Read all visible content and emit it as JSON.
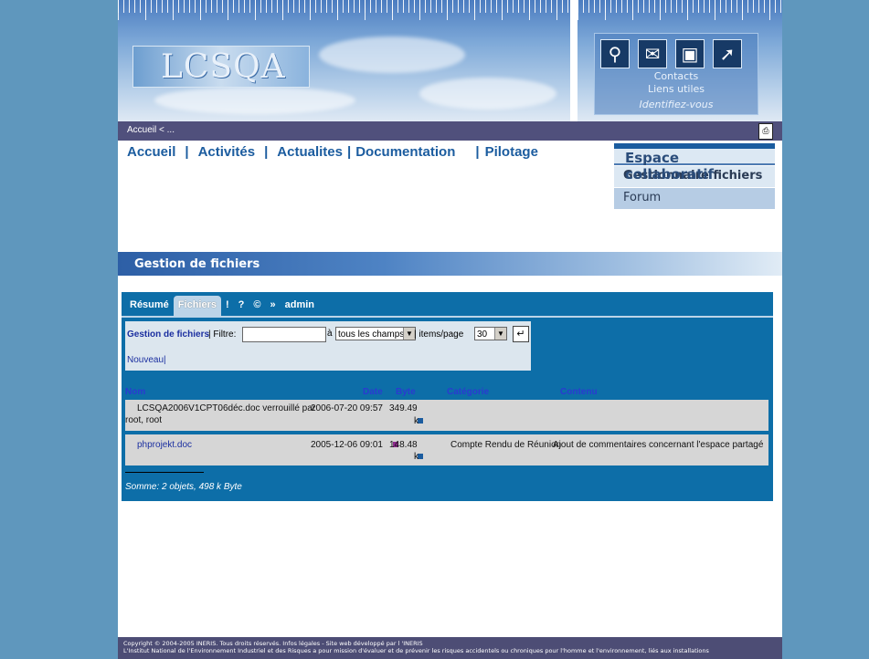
{
  "header": {
    "logo_text": "LCSQA",
    "toolbox": {
      "icons": [
        "search-icon",
        "mail-icon",
        "fullscreen-icon",
        "compass-icon"
      ],
      "contacts": "Contacts",
      "liens": "Liens utiles",
      "identify": "Identifiez-vous"
    }
  },
  "breadcrumb": {
    "text": "Accueil  < ..."
  },
  "nav": {
    "items": [
      "Accueil",
      "Activités",
      "Actualites",
      "Documentation",
      "Pilotage"
    ],
    "separator": "|"
  },
  "side_menu": {
    "title": "Espace collaboratif",
    "items": [
      "Gestionnaire fichiers",
      "Forum"
    ]
  },
  "section": {
    "title": "Gestion de fichiers"
  },
  "app": {
    "tabs": [
      "Résumé",
      "Fichiers",
      "!",
      "?",
      "©",
      "»",
      "admin"
    ],
    "filter": {
      "title": "Gestion de fichiers",
      "filter_label": "| Filtre:",
      "a_label": "à",
      "field_select": "tous les champs",
      "items_label": "|  items/page",
      "items_select": "30",
      "new_link": "Nouveau",
      "new_sep": "|"
    },
    "table": {
      "headers": [
        "Nom",
        "Date",
        "Byte",
        "Catégorie",
        "Contenu"
      ],
      "rows": [
        {
          "name_line1": "LCSQA2006V1CPT06déc.doc verrouillé par",
          "name_line2": "root, root",
          "date": "2006-07-20 09:57",
          "byte": "349.49",
          "unit": "k",
          "category": "",
          "content": ""
        },
        {
          "name_line1": "phprojekt.doc",
          "name_line2": "",
          "date": "2005-12-06 09:01",
          "byte": "148.48",
          "unit": "k",
          "category": "Compte Rendu de Réunion",
          "content": "Ajout de commentaires concernant l'espace partagé"
        }
      ]
    },
    "summary": "Somme: 2 objets, 498 k Byte"
  },
  "footer": {
    "line1": "Copyright © 2004-2005 INERIS. Tous droits réservés. Infos légales - Site web développé par l 'INERIS",
    "line2": "L'Institut National de l'Environnement Industriel et des Risques a pour mission d'évaluer et de prévenir les risques accidentels ou chroniques pour l'homme et l'environnement, liés aux installations"
  },
  "colors": {
    "page_bg": "#5f97bd",
    "nav_text": "#1b5c9f",
    "app_bg": "#0d6ea8",
    "bar": "#50507c",
    "purple_square": "#8e2c8e",
    "blue_square": "#1b5c9f"
  }
}
